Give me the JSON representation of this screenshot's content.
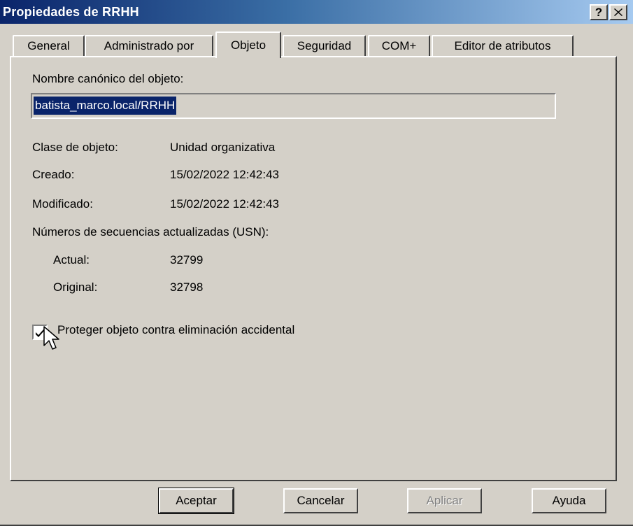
{
  "window": {
    "title": "Propiedades de RRHH"
  },
  "titlebar_buttons": {
    "help": "?"
  },
  "tabs": [
    {
      "label": "General"
    },
    {
      "label": "Administrado por"
    },
    {
      "label": "Objeto"
    },
    {
      "label": "Seguridad"
    },
    {
      "label": "COM+"
    },
    {
      "label": "Editor de atributos"
    }
  ],
  "active_tab": "Objeto",
  "object": {
    "canonical_label": "Nombre canónico del objeto:",
    "canonical_value": "batista_marco.local/RRHH",
    "class_label": "Clase de objeto:",
    "class_value": "Unidad organizativa",
    "created_label": "Creado:",
    "created_value": "15/02/2022 12:42:43",
    "modified_label": "Modificado:",
    "modified_value": "15/02/2022 12:42:43",
    "usn_label": "Números de secuencias actualizadas (USN):",
    "current_label": "Actual:",
    "current_value": "32799",
    "original_label": "Original:",
    "original_value": "32798",
    "protect_label": "Proteger objeto contra eliminación accidental",
    "protect_checked": true
  },
  "buttons": {
    "ok": "Aceptar",
    "cancel": "Cancelar",
    "apply": "Aplicar",
    "help": "Ayuda"
  },
  "colors": {
    "face": "#d4d0c8",
    "title_start": "#0a246a",
    "title_end": "#a6caf0",
    "selection": "#0a246a"
  }
}
